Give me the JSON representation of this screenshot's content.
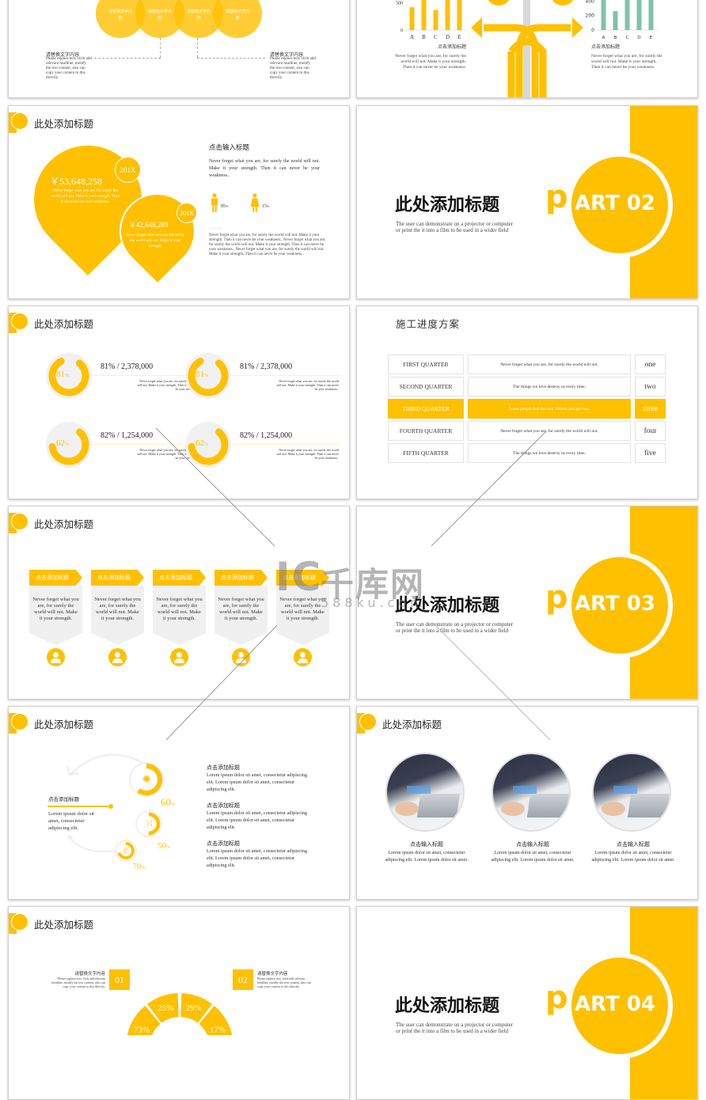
{
  "slide1": {
    "circles": [
      "请替换文字内容",
      "请替换文字内容",
      "请替换文字内容",
      "请替换文字内容"
    ],
    "left": {
      "title": "请替换文字内容",
      "body": "Please replace text, click add relevant headline, modify the text content, also can copy your content to this directly."
    },
    "right": {
      "title": "请替换文字内容",
      "body": "Please replace text, click add relevant headline, modify the text content, also can copy your content to this directly."
    }
  },
  "slide2": {
    "left_chart": {
      "y_ticks": [
        "500",
        "0"
      ],
      "categories": [
        "A",
        "B",
        "C",
        "D",
        "E"
      ],
      "color": "#FFC000"
    },
    "right_chart": {
      "y_ticks": [
        "400",
        "200",
        "0"
      ],
      "categories": [
        "A",
        "B",
        "C",
        "D",
        "E"
      ],
      "color": "#7DC3AA"
    },
    "left_title": "点击添加标题",
    "left_body": "Never forget what you are, for surely the world will not. Make it your strength. Then it can never be your weakness.",
    "right_title": "点击添加标题",
    "right_body": "Never forget what you are, for surely the world will not. Make it your strength. Then it can never be your weakness."
  },
  "chart_data": [
    {
      "type": "bar",
      "title": "",
      "categories": [
        "A",
        "B",
        "C",
        "D",
        "E"
      ],
      "values": [
        420,
        690,
        370,
        650,
        760
      ],
      "ylim": [
        0,
        800
      ],
      "y_ticks": [
        0,
        500
      ],
      "color": "#FFC000"
    },
    {
      "type": "bar",
      "title": "",
      "categories": [
        "A",
        "B",
        "C",
        "D",
        "E"
      ],
      "values": [
        540,
        260,
        440,
        620,
        620
      ],
      "ylim": [
        0,
        600
      ],
      "y_ticks": [
        0,
        200,
        400
      ],
      "color": "#7DC3AA"
    }
  ],
  "slide3": {
    "title": "此处添加标题",
    "drop1": {
      "year": "201X",
      "amount": "￥53,648,258",
      "body": "Never forget what you are, for surely the world will not. Make it your strength. Then it can never be your weakness.."
    },
    "drop2": {
      "year": "201X",
      "amount": "￥42,648,289",
      "body": "Never forget what you are, for surely the world will not. Make it your strength."
    },
    "heading": "点击输入标题",
    "intro": "Never forget what you are, for surely the world will not. Make it your strength. Then it can never be your weakness..",
    "male_pct": "85",
    "female_pct": "15",
    "pct_unit": "%",
    "body": "Never forget what you are, for surely the world will not. Make it your strength. Then it can never be your weakness.. Never forget what you are, for surely the world will not. Make it your strength. Then it can never be your weakness.. Never forget what you are, for surely the world will not. Make it your strength. Then it can never be your weakness.."
  },
  "part02": {
    "title": "此处添加标题",
    "sub": "The user can demonstrate on a projector or computer or print the it into a film to be used in a wider field",
    "p": "p",
    "art": "ART 02"
  },
  "slide5": {
    "title": "此处添加标题",
    "items": [
      {
        "pct": "81",
        "headline": "81% / 2,378,000",
        "body": "Never forget what you are, for surely the world will not. Make it your strength. Then it can never be your weakness.."
      },
      {
        "pct": "81",
        "headline": "81% / 2,378,000",
        "body": "Never forget what you are, for surely the world will not. Make it your strength. Then it can never be your weakness.."
      },
      {
        "pct": "62",
        "headline": "82% / 1,254,000",
        "body": "Never forget what you are, for surely the world will not. Make it your strength. Then it can never be your weakness.."
      },
      {
        "pct": "62",
        "headline": "82% / 1,254,000",
        "body": "Never forget what you are, for surely the world will not. Make it your strength. Then it can never be your weakness.."
      }
    ],
    "unit": "%"
  },
  "slide6": {
    "title": "施工进度方案",
    "rows": [
      {
        "q": "FIRST QUARTER",
        "text": "Never forget what you are, for surely the world will not.",
        "n": "one",
        "highlight": false
      },
      {
        "q": "SECOND QUARTER",
        "text": "The things we love destroy us every time.",
        "n": "two",
        "highlight": false
      },
      {
        "q": "THIRD QUARTER",
        "text": "Some people feel the rain. Others just get wet.",
        "n": "three",
        "highlight": true
      },
      {
        "q": "FOURTH QUARTER",
        "text": "Never forget what you are, for surely the world will not.",
        "n": "four",
        "highlight": false
      },
      {
        "q": "FIFTH QUARTER",
        "text": "The things we love destroy us every time.",
        "n": "five",
        "highlight": false
      }
    ]
  },
  "slide7": {
    "title": "此处添加标题",
    "cards": [
      {
        "label": "点击添加标题",
        "body": "Never forget what you are, for surely the world will not. Make it your strength."
      },
      {
        "label": "点击添加标题",
        "body": "Never forget what you are, for surely the world will not. Make it your strength."
      },
      {
        "label": "点击添加标题",
        "body": "Never forget what you are, for surely the world will not. Make it your strength."
      },
      {
        "label": "点击添加标题",
        "body": "Never forget what you are, for surely the world will not. Make it your strength."
      },
      {
        "label": "点击添加标题",
        "body": "Never forget what you are, for surely the world will not. Make it your strength."
      }
    ]
  },
  "part03": {
    "title": "此处添加标题",
    "sub": "The user can demonstrate on a projector or computer or print the it into a film to be used in a wider field",
    "p": "p",
    "art": "ART 03"
  },
  "slide9": {
    "title": "此处添加标题",
    "left_title": "点击添加标题",
    "left_body": "Lorem ipsum dolor sit amet, consectetur adipiscing elit.",
    "rings": [
      {
        "pct": "60",
        "icon": "network-icon"
      },
      {
        "pct": "50",
        "icon": "shuffle-icon"
      },
      {
        "pct": "70",
        "icon": "phone-icon"
      }
    ],
    "unit": "%",
    "items": [
      {
        "title": "点击添加标题",
        "body": "Lorem ipsum dolor sit amet, consectetur adipiscing elit. Lorem ipsum dolor sit amet, consectetur adipiscing elit."
      },
      {
        "title": "点击添加标题",
        "body": "Lorem ipsum dolor sit amet, consectetur adipiscing elit. Lorem ipsum dolor sit amet, consectetur adipiscing elit."
      },
      {
        "title": "点击添加标题",
        "body": "Lorem ipsum dolor sit amet, consectetur adipiscing elit. Lorem ipsum dolor sit amet, consectetur adipiscing elit."
      }
    ]
  },
  "slide10": {
    "title": "此处添加标题",
    "items": [
      {
        "title": "点击输入标题",
        "body": "Lorem ipsum dolor sit amet, consectetur adipiscing elit. Lorem ipsum dolor sit amet."
      },
      {
        "title": "点击输入标题",
        "body": "Lorem ipsum dolor sit amet, consectetur adipiscing elit. Lorem ipsum dolor sit amet."
      },
      {
        "title": "点击输入标题",
        "body": "Lorem ipsum dolor sit amet, consectetur adipiscing elit. Lorem ipsum dolor sit amet."
      }
    ]
  },
  "slide11": {
    "title": "此处添加标题",
    "left": {
      "num": "01",
      "title": "请替换文字内容",
      "body": "Please replace text, click add relevant headline, modify the text content, also can copy your content to this directly."
    },
    "right": {
      "num": "02",
      "title": "请替换文字内容",
      "body": "Please replace text, click add relevant headline, modify the text content, also can copy your content to this directly."
    },
    "segments": [
      "25%",
      "29%",
      "73%",
      "17%"
    ]
  },
  "part04": {
    "title": "此处添加标题",
    "sub": "The user can demonstrate on a projector or computer or print the it into a film to be used in a wider field",
    "p": "p",
    "art": "ART 04"
  },
  "watermark": {
    "logo": "IC",
    "brand": "千库网",
    "url": "588ku.com"
  }
}
